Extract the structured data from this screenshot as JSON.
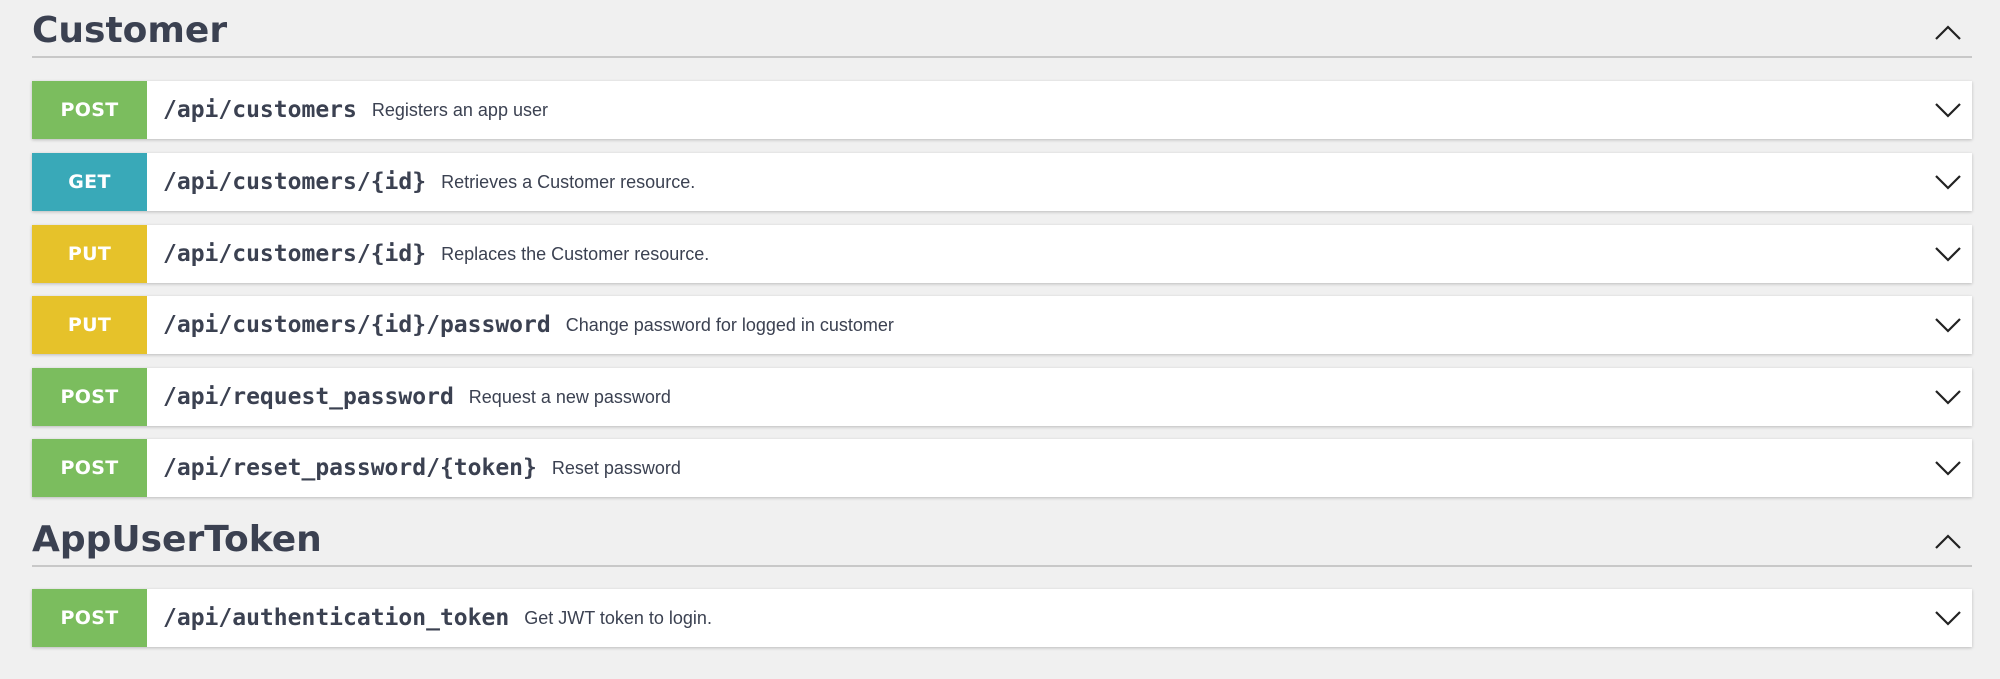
{
  "sections": [
    {
      "title": "Customer",
      "toggle_icon": "chevron-up-icon",
      "operations": [
        {
          "method": "POST",
          "path": "/api/customers",
          "summary": "Registers an app user"
        },
        {
          "method": "GET",
          "path": "/api/customers/{id}",
          "summary": "Retrieves a Customer resource."
        },
        {
          "method": "PUT",
          "path": "/api/customers/{id}",
          "summary": "Replaces the Customer resource."
        },
        {
          "method": "PUT",
          "path": "/api/customers/{id}/password",
          "summary": "Change password for logged in customer"
        },
        {
          "method": "POST",
          "path": "/api/request_password",
          "summary": "Request a new password"
        },
        {
          "method": "POST",
          "path": "/api/reset_password/{token}",
          "summary": "Reset password"
        }
      ]
    },
    {
      "title": "AppUserToken",
      "toggle_icon": "chevron-up-icon",
      "operations": [
        {
          "method": "POST",
          "path": "/api/authentication_token",
          "summary": "Get JWT token to login."
        }
      ]
    }
  ],
  "colors": {
    "post": "#7bbd5e",
    "get": "#39a9b8",
    "put": "#e6c22a",
    "text": "#3b4151",
    "background": "#f0f0f0"
  },
  "icons": {
    "expand": "chevron-down-icon",
    "collapse": "chevron-up-icon"
  }
}
